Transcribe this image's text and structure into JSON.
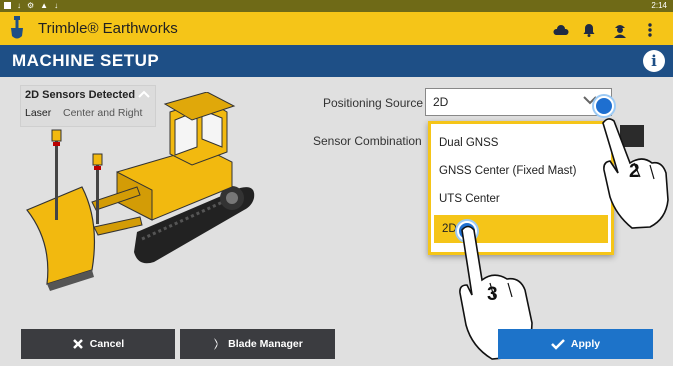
{
  "statusbar": {
    "time": "2:14"
  },
  "app": {
    "title": "Trimble® Earthworks"
  },
  "page": {
    "title": "MACHINE SETUP"
  },
  "sensors": {
    "title": "2D Sensors Detected",
    "label": "Laser",
    "value": "Center and Right"
  },
  "form": {
    "positioning_label": "Positioning Source",
    "positioning_value": "2D",
    "sensor_combo_label": "Sensor Combination"
  },
  "dropdown": {
    "options": [
      "Dual GNSS",
      "GNSS Center (Fixed Mast)",
      "UTS Center",
      "2D"
    ],
    "selected": "2D"
  },
  "footer": {
    "cancel": "Cancel",
    "blade_manager": "Blade Manager",
    "apply": "Apply"
  },
  "callouts": {
    "step_2": "2",
    "step_3": "3"
  },
  "colors": {
    "appbar": "#f5c518",
    "titlebar": "#1e4f86",
    "apply": "#1d73c9",
    "footer_button": "#3b3c40"
  },
  "icons": [
    "trimble-logo-icon",
    "cloud-icon",
    "bell-icon",
    "operator-icon",
    "more-vertical-icon",
    "info-icon",
    "chevron-up-icon",
    "chevron-down-icon",
    "close-icon",
    "blade-icon",
    "check-icon"
  ]
}
